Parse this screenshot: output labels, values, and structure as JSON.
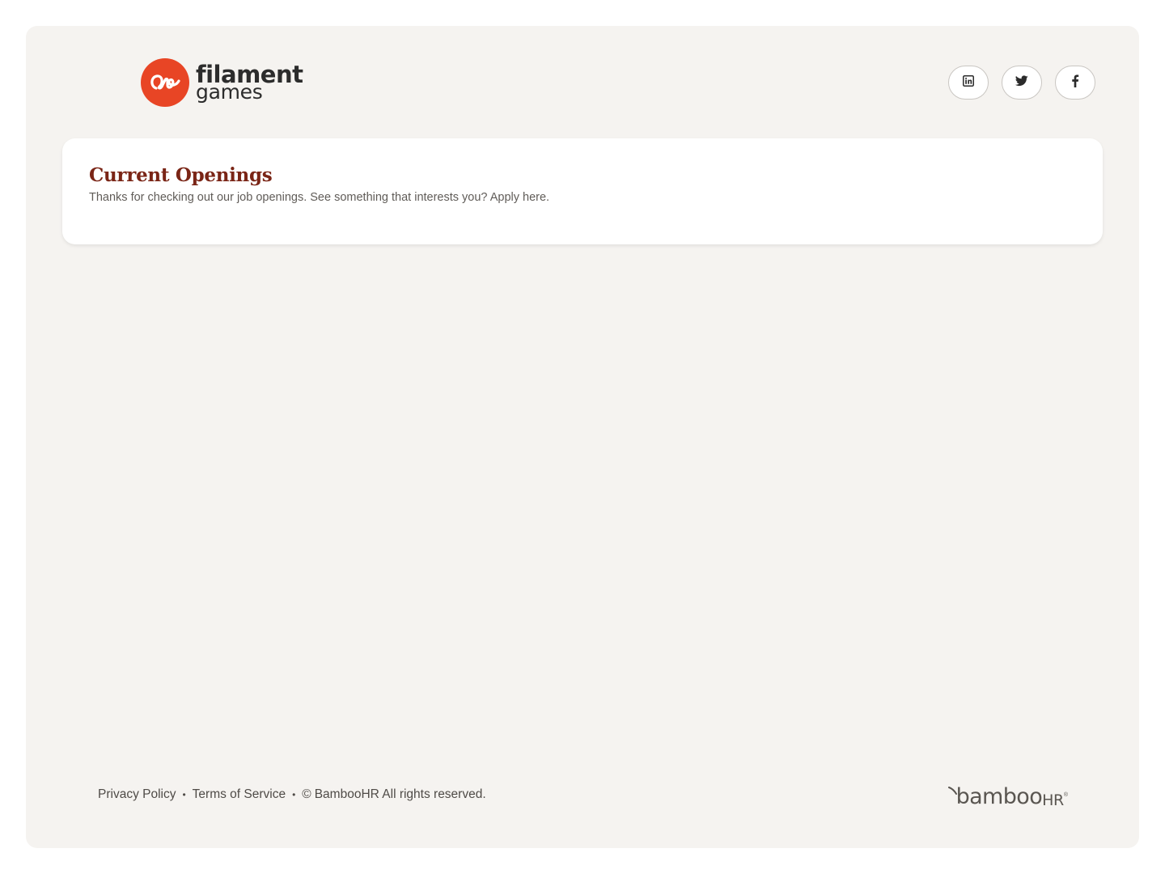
{
  "header": {
    "logo": {
      "word1": "filament",
      "word2": "games",
      "brand_color": "#e84525"
    },
    "social": [
      {
        "name": "linkedin",
        "icon": "linkedin-icon"
      },
      {
        "name": "twitter",
        "icon": "twitter-icon"
      },
      {
        "name": "facebook",
        "icon": "facebook-icon"
      }
    ]
  },
  "main": {
    "title": "Current Openings",
    "subtitle": "Thanks for checking out our job openings. See something that interests you? Apply here."
  },
  "footer": {
    "privacy": "Privacy Policy",
    "terms": "Terms of Service",
    "copyright": "BambooHR All rights reserved.",
    "copyright_symbol": "©",
    "separator": "•",
    "brand": {
      "word": "bamboo",
      "suffix": "HR",
      "tm": "®"
    }
  },
  "colors": {
    "page_bg": "#f5f3f0",
    "title": "#7a2516",
    "text": "#605c58"
  }
}
